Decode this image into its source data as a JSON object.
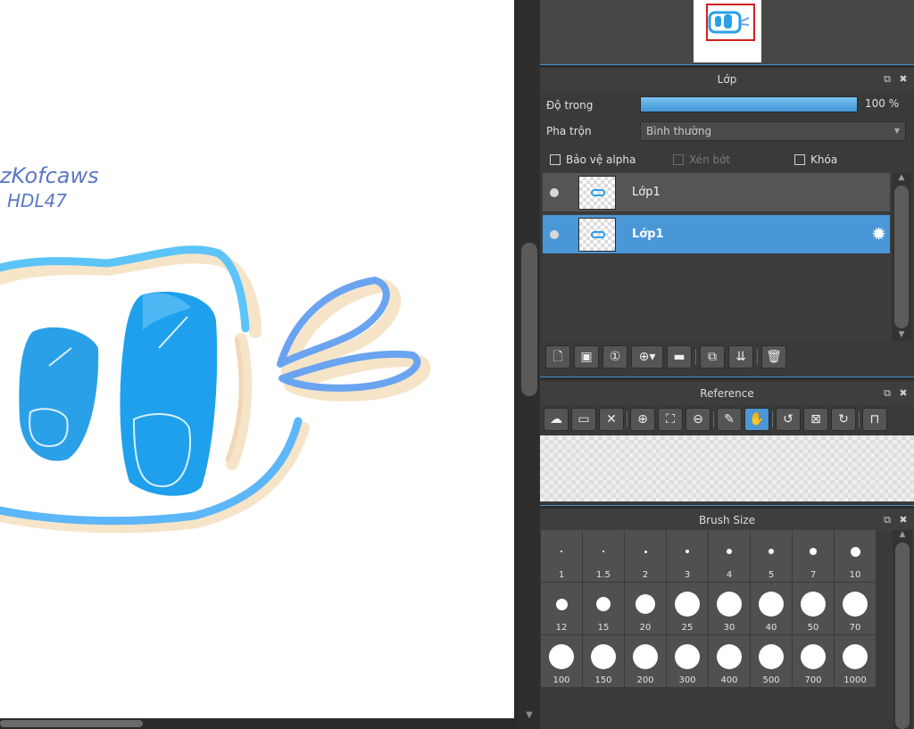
{
  "canvas": {
    "handwriting_line1": "zKofcaws",
    "handwriting_line2": "HDL47"
  },
  "layer_panel": {
    "title": "Lớp",
    "opacity_label": "Độ trong",
    "opacity_value": "100 %",
    "opacity_fraction": 1.0,
    "blend_label": "Pha trộn",
    "blend_value": "Bình thường",
    "checks": [
      {
        "label": "Bảo vệ alpha",
        "checked": false,
        "enabled": true
      },
      {
        "label": "Xén bớt",
        "checked": false,
        "enabled": false
      },
      {
        "label": "Khóa",
        "checked": false,
        "enabled": true
      }
    ],
    "layers": [
      {
        "name": "Lớp1",
        "selected": false
      },
      {
        "name": "Lớp1",
        "selected": true
      }
    ]
  },
  "reference_panel": {
    "title": "Reference"
  },
  "brush_panel": {
    "title": "Brush Size",
    "sizes": [
      "1",
      "1.5",
      "2",
      "3",
      "4",
      "5",
      "7",
      "10",
      "12",
      "15",
      "20",
      "25",
      "30",
      "40",
      "50",
      "70",
      "100",
      "150",
      "200",
      "300",
      "400",
      "500",
      "700",
      "1000"
    ]
  },
  "colors": {
    "accent": "#4a97d8",
    "stroke_blue": "#2aa0e8",
    "stroke_light_blue": "#5cc4f8",
    "shadow_beige": "#f6e2c4"
  },
  "icons": {
    "header": [
      "popout-icon",
      "close-icon"
    ],
    "layer_toolbar": [
      "new-layer-icon",
      "new-page-icon",
      "new-layer-1bit-icon",
      "add-layer-menu-icon",
      "folder-icon",
      "duplicate-icon",
      "merge-icon",
      "delete-icon"
    ],
    "reference_toolbar": [
      "upload-icon",
      "open-folder-icon",
      "close-icon",
      "zoom-in-icon",
      "fit-icon",
      "zoom-out-icon",
      "eyedropper-icon",
      "hand-icon",
      "rotate-left-icon",
      "fullscreen-icon",
      "rotate-right-icon",
      "lock-icon"
    ]
  }
}
